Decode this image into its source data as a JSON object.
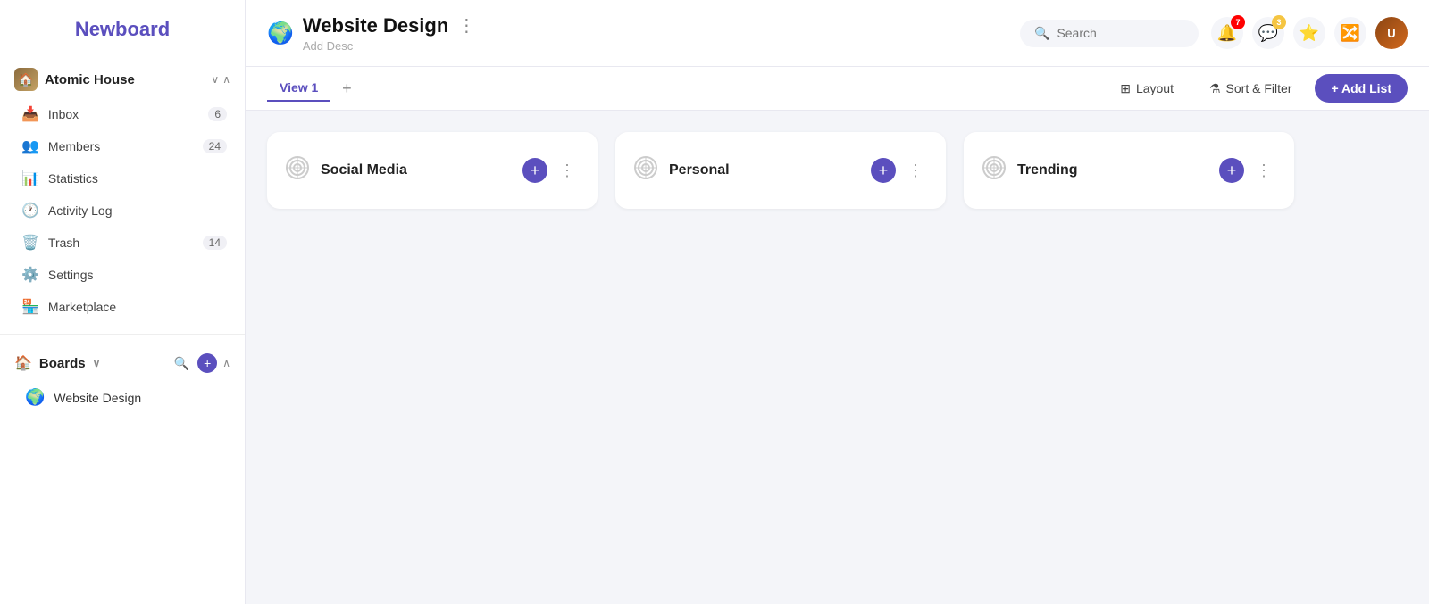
{
  "sidebar": {
    "logo": "Newboard",
    "workspace": {
      "name": "Atomic House",
      "icon": "🏠",
      "chevron": "∨"
    },
    "nav_items": [
      {
        "id": "inbox",
        "label": "Inbox",
        "icon": "📥",
        "badge": "6"
      },
      {
        "id": "members",
        "label": "Members",
        "icon": "👥",
        "badge": "24"
      },
      {
        "id": "statistics",
        "label": "Statistics",
        "icon": "📊",
        "badge": ""
      },
      {
        "id": "activity-log",
        "label": "Activity Log",
        "icon": "🕐",
        "badge": ""
      },
      {
        "id": "trash",
        "label": "Trash",
        "icon": "🗑️",
        "badge": "14"
      },
      {
        "id": "settings",
        "label": "Settings",
        "icon": "⚙️",
        "badge": ""
      },
      {
        "id": "marketplace",
        "label": "Marketplace",
        "icon": "🏪",
        "badge": ""
      }
    ],
    "boards_section": {
      "label": "Boards",
      "items": [
        {
          "id": "website-design",
          "label": "Website Design",
          "emoji": "🌍"
        }
      ]
    }
  },
  "header": {
    "board_emoji": "🌍",
    "board_title": "Website Design",
    "add_desc": "Add Desc",
    "more_icon": "⋮",
    "search_placeholder": "Search",
    "notifications_badge": "7",
    "avatar_initials": "U"
  },
  "toolbar": {
    "tabs": [
      {
        "id": "view1",
        "label": "View 1",
        "active": true
      }
    ],
    "add_tab_label": "+",
    "layout_label": "Layout",
    "sort_filter_label": "Sort & Filter",
    "add_list_label": "+ Add List"
  },
  "lists": [
    {
      "id": "social-media",
      "title": "Social Media"
    },
    {
      "id": "personal",
      "title": "Personal"
    },
    {
      "id": "trending",
      "title": "Trending"
    }
  ],
  "colors": {
    "brand": "#5b4fbe",
    "accent_yellow": "#f5c542",
    "nav_bg": "#fff",
    "main_bg": "#f4f5f9"
  }
}
